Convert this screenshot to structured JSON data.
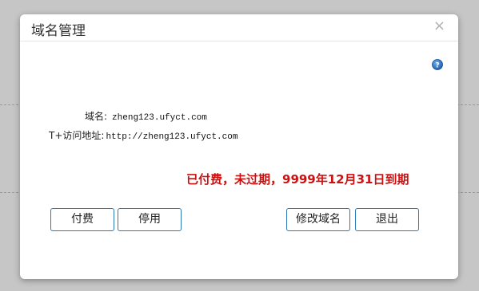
{
  "dialog": {
    "title": "域名管理",
    "close_symbol": "×",
    "help_icon": "question-circle-icon",
    "help_symbol": "?"
  },
  "fields": {
    "domain_label": "域名:",
    "domain_value": "zheng123.ufyct.com",
    "url_label": "T+访问地址:",
    "url_value": "http://zheng123.ufyct.com"
  },
  "status": {
    "text": "已付费，未过期，9999年12月31日到期",
    "color": "#cc1111"
  },
  "buttons": {
    "pay": "付费",
    "disable": "停用",
    "modify_domain": "修改域名",
    "exit": "退出"
  },
  "colors": {
    "button_border": "#2a7ab8",
    "help_icon": "#1f6fc1",
    "backdrop": "#c6c6c6"
  }
}
